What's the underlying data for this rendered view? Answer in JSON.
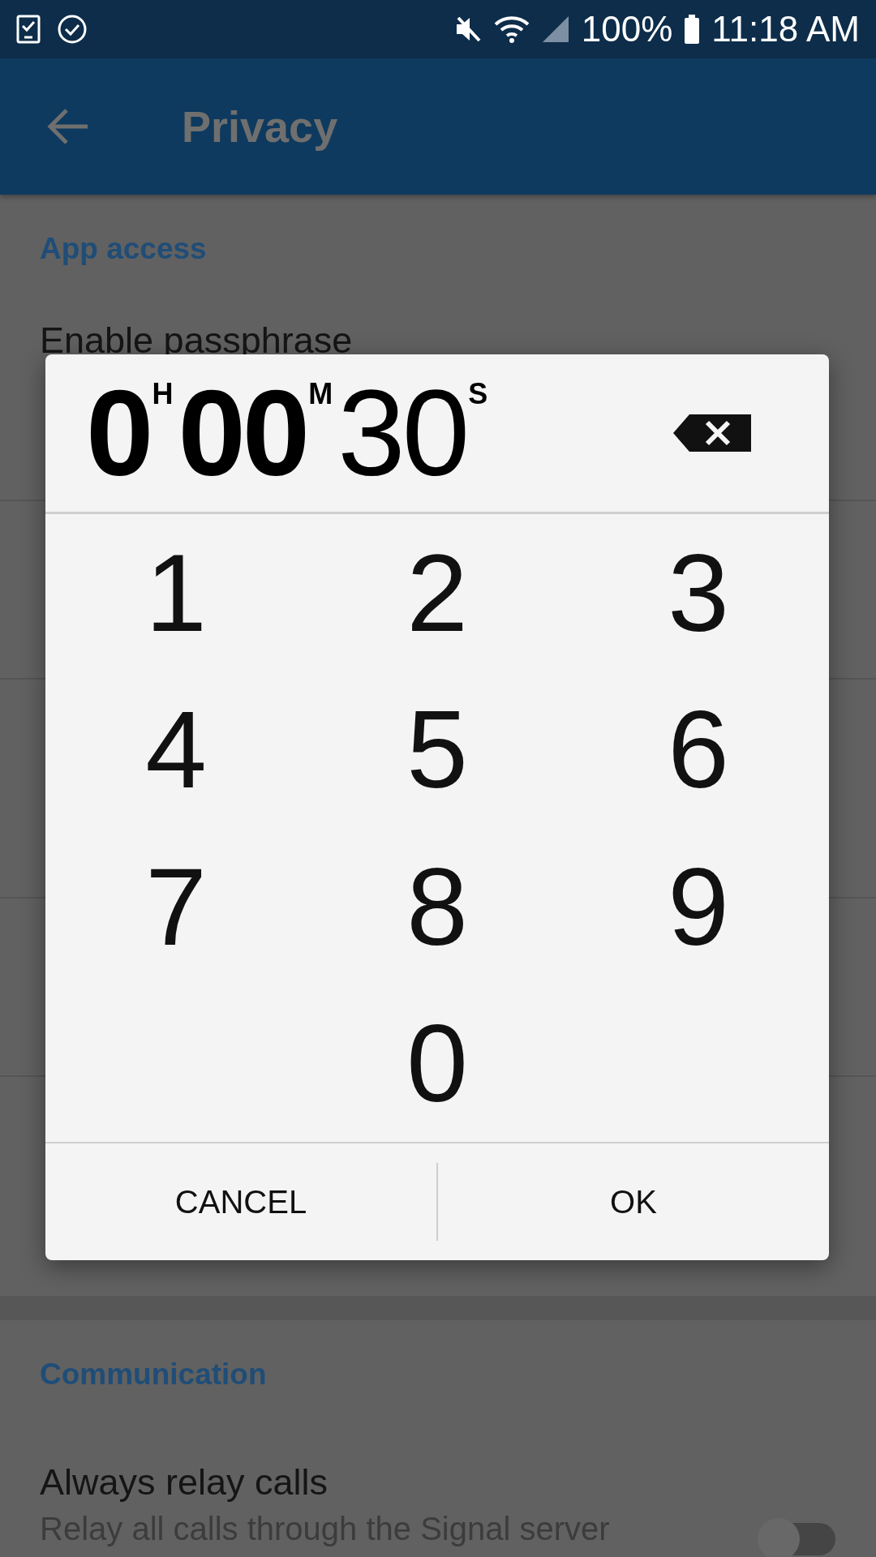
{
  "status_bar": {
    "battery": "100%",
    "time": "11:18 AM"
  },
  "app_bar": {
    "title": "Privacy"
  },
  "sections": [
    {
      "heading": "App access",
      "rows": [
        {
          "title": "Enable passphrase"
        }
      ]
    },
    {
      "heading": "Communication",
      "rows": [
        {
          "title": "Always relay calls",
          "subtitle_lines": [
            "Relay all calls through the Signal server"
          ],
          "toggle": {
            "checked": false
          }
        }
      ]
    }
  ],
  "dialog": {
    "time_units": [
      {
        "value": "0",
        "unit": "H",
        "entered": false
      },
      {
        "value": "00",
        "unit": "M",
        "entered": false
      },
      {
        "value": "30",
        "unit": "S",
        "entered": true
      }
    ],
    "keys": [
      "1",
      "2",
      "3",
      "4",
      "5",
      "6",
      "7",
      "8",
      "9",
      "0"
    ],
    "buttons": [
      "CANCEL",
      "OK"
    ]
  }
}
